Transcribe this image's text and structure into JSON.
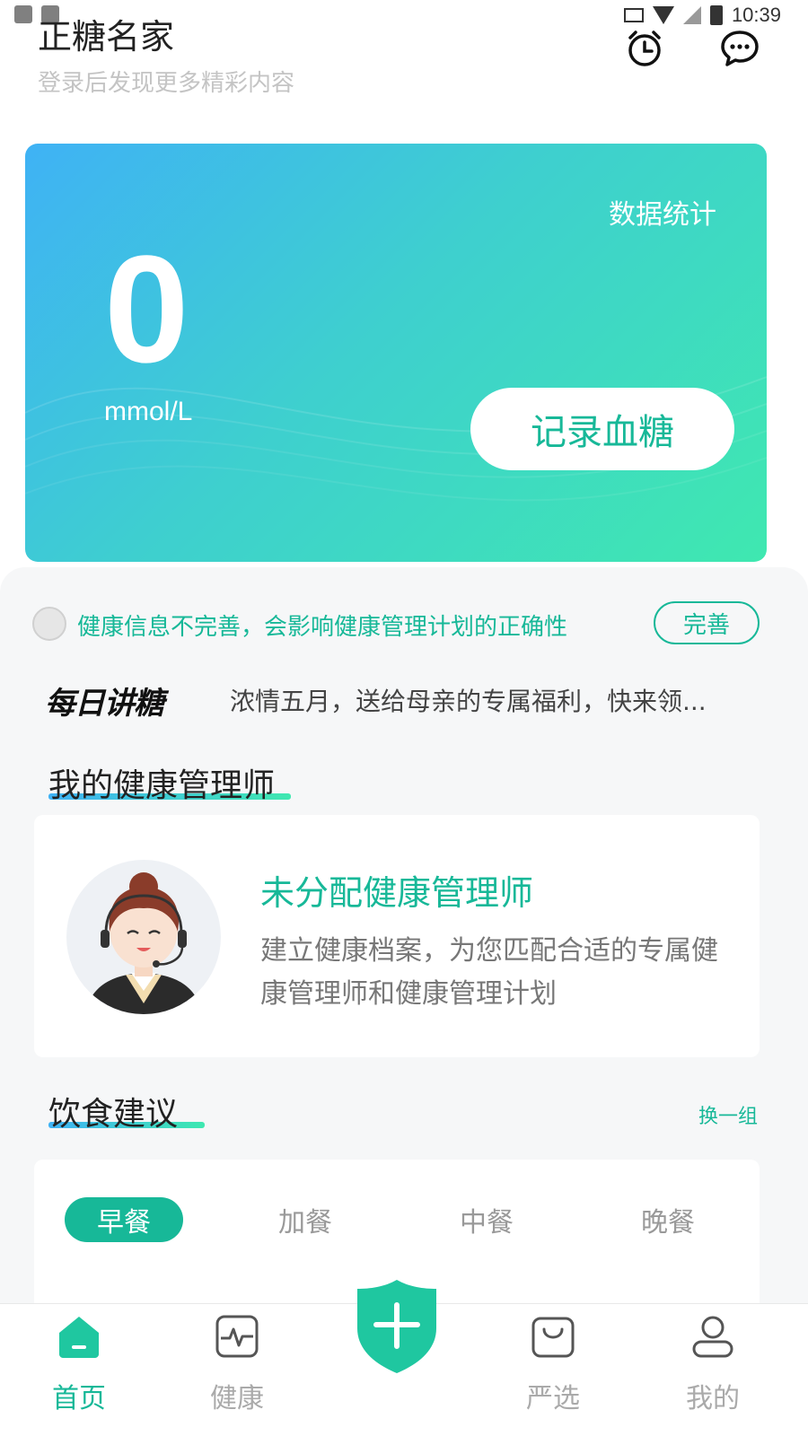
{
  "status_bar": {
    "time": "10:39"
  },
  "header": {
    "title": "正糖名家",
    "subtitle": "登录后发现更多精彩内容"
  },
  "hero": {
    "stats_link": "数据统计",
    "value": "0",
    "unit": "mmol/L",
    "record_button": "记录血糖"
  },
  "notice": {
    "text": "健康信息不完善，会影响健康管理计划的正确性",
    "button": "完善"
  },
  "daily": {
    "logo": "每日讲糖",
    "headline": "浓情五月，送给母亲的专属福利，快来领..."
  },
  "manager_section": {
    "title": "我的健康管理师",
    "name": "未分配健康管理师",
    "description": "建立健康档案，为您匹配合适的专属健康管理师和健康管理计划"
  },
  "diet_section": {
    "title": "饮食建议",
    "swap": "换一组",
    "tabs": [
      "早餐",
      "加餐",
      "中餐",
      "晚餐"
    ],
    "active_tab": "早餐"
  },
  "bottom_nav": {
    "items": [
      {
        "label": "首页",
        "icon": "home-icon",
        "active": true
      },
      {
        "label": "健康",
        "icon": "pulse-icon",
        "active": false
      },
      {
        "label": "",
        "icon": "add-shield-icon",
        "active": false
      },
      {
        "label": "严选",
        "icon": "bag-icon",
        "active": false
      },
      {
        "label": "我的",
        "icon": "user-icon",
        "active": false
      }
    ]
  },
  "colors": {
    "accent": "#17b898",
    "gradient_start": "#3fb2f5",
    "gradient_end": "#3fe8b0"
  }
}
